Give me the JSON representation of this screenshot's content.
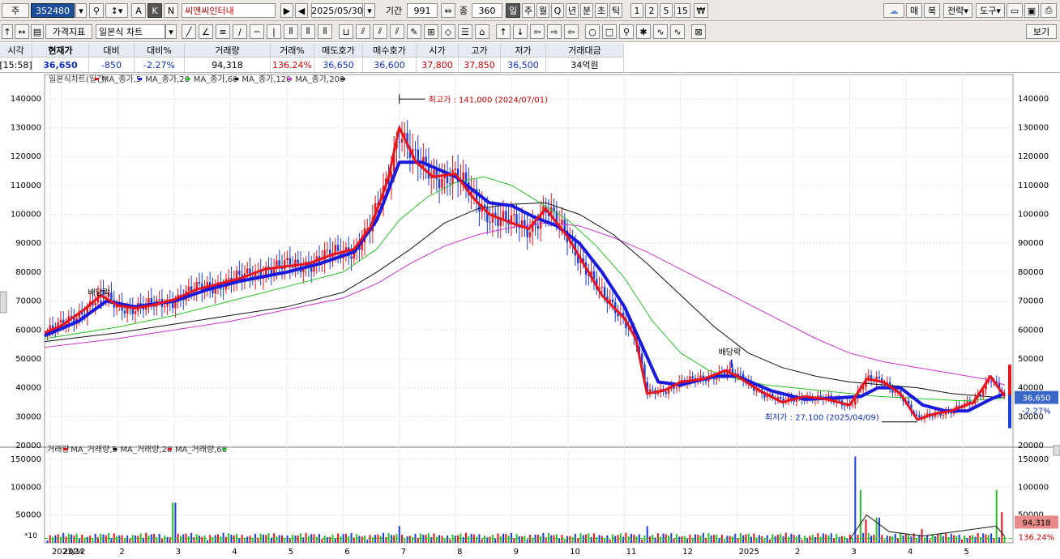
{
  "toolbar1": {
    "market_label": "주",
    "code": "352480",
    "name": "씨앤씨인터내",
    "date": "2025/05/30",
    "period_label": "기간",
    "period_value": "991",
    "count_label": "종",
    "count_value": "360",
    "mode_buttons": [
      "A",
      "K",
      "N"
    ],
    "interval_buttons": [
      "일",
      "주",
      "월",
      "Q",
      "년",
      "분",
      "초",
      "틱",
      "1",
      "2",
      "5",
      "15"
    ],
    "right_buttons": [
      "매",
      "복",
      "전략",
      "도구"
    ]
  },
  "toolbar2": {
    "indicator_label": "가격지표",
    "chart_type": "일본식 차트",
    "view_button": "보기"
  },
  "quote": {
    "headers": [
      "시각",
      "현재가",
      "대비",
      "대비%",
      "거래량",
      "거래%",
      "매도호가",
      "매수호가",
      "시가",
      "고가",
      "저가",
      "거래대금"
    ],
    "values": [
      "[15:58]",
      "36,650",
      "-850",
      "-2.27%",
      "94,318",
      "136.24%",
      "36,650",
      "36,600",
      "37,800",
      "37,850",
      "36,500",
      "34억원"
    ]
  },
  "chart_data": {
    "type": "line",
    "price_legend": [
      "일본식차트(일간)",
      "MA_종가,5",
      "MA_종가,20",
      "MA_종가,60",
      "MA_종가,120",
      "MA_종가,200"
    ],
    "volume_legend": [
      "거래량",
      "MA_거래량,5",
      "MA_거래량,20",
      "MA_거래량,60"
    ],
    "price_axis_ticks": [
      "140000",
      "130000",
      "120000",
      "110000",
      "100000",
      "90000",
      "80000",
      "70000",
      "60000",
      "50000",
      "40000",
      "30000",
      "20000"
    ],
    "volume_axis_ticks": [
      "150000",
      "100000",
      "50000"
    ],
    "volume_scale_label": "*10",
    "x_labels": [
      "2023/12",
      "2024",
      "2",
      "3",
      "4",
      "5",
      "6",
      "7",
      "8",
      "9",
      "10",
      "11",
      "12",
      "2025",
      "2",
      "3",
      "4",
      "5"
    ],
    "x_months": [
      -0.2,
      0,
      1,
      2,
      3,
      4,
      5,
      6,
      7,
      8,
      9,
      10,
      11,
      12,
      13,
      14,
      15,
      16
    ],
    "price_ylim": [
      20000,
      145000
    ],
    "volume_ylim": [
      0,
      160000
    ],
    "annotations": {
      "high": "최고가 : 141,000 (2024/07/01)",
      "low": "최저가 : 27,100 (2025/04/09)",
      "dividend1": "배당락",
      "dividend2": "배당락",
      "current_price": "36,650",
      "current_change": "-2.27%",
      "current_volume": "94,318",
      "current_volume_pct": "136.24%"
    },
    "colors": {
      "ma5": "#e8141c",
      "ma20": "#1a1adc",
      "ma60": "#27c227",
      "ma120": "#111111",
      "ma200": "#d030d0",
      "up": "#e8141c",
      "down": "#1a3cdc"
    },
    "ma5": [
      [
        -0.3,
        59000
      ],
      [
        0,
        61500
      ],
      [
        0.4,
        67000
      ],
      [
        0.7,
        72000
      ],
      [
        1,
        68500
      ],
      [
        1.3,
        67500
      ],
      [
        1.6,
        68500
      ],
      [
        2,
        70500
      ],
      [
        2.4,
        74000
      ],
      [
        2.8,
        76000
      ],
      [
        3.2,
        78000
      ],
      [
        3.6,
        81000
      ],
      [
        4,
        82000
      ],
      [
        4.4,
        83000
      ],
      [
        4.8,
        86000
      ],
      [
        5.2,
        88000
      ],
      [
        5.5,
        96000
      ],
      [
        5.8,
        112000
      ],
      [
        6,
        130000
      ],
      [
        6.3,
        118000
      ],
      [
        6.6,
        113000
      ],
      [
        7,
        114000
      ],
      [
        7.3,
        106000
      ],
      [
        7.6,
        100000
      ],
      [
        8,
        97000
      ],
      [
        8.3,
        95000
      ],
      [
        8.6,
        102000
      ],
      [
        9,
        92000
      ],
      [
        9.3,
        82000
      ],
      [
        9.6,
        72000
      ],
      [
        10,
        64000
      ],
      [
        10.2,
        57000
      ],
      [
        10.4,
        38000
      ],
      [
        10.7,
        39000
      ],
      [
        11,
        42000
      ],
      [
        11.4,
        43000
      ],
      [
        11.8,
        46000
      ],
      [
        12,
        44000
      ],
      [
        12.4,
        39000
      ],
      [
        12.8,
        35000
      ],
      [
        13.2,
        37000
      ],
      [
        13.6,
        36000
      ],
      [
        14,
        34000
      ],
      [
        14.3,
        43000
      ],
      [
        14.6,
        42000
      ],
      [
        14.9,
        38000
      ],
      [
        15.2,
        29000
      ],
      [
        15.5,
        31000
      ],
      [
        15.8,
        32000
      ],
      [
        16.2,
        35000
      ],
      [
        16.5,
        44000
      ],
      [
        16.75,
        37000
      ]
    ],
    "ma20": [
      [
        -0.3,
        58000
      ],
      [
        0.3,
        63000
      ],
      [
        0.8,
        70000
      ],
      [
        1.3,
        68000
      ],
      [
        2,
        70000
      ],
      [
        2.6,
        74000
      ],
      [
        3.2,
        77000
      ],
      [
        4,
        80000
      ],
      [
        4.6,
        83000
      ],
      [
        5.2,
        87000
      ],
      [
        5.6,
        98000
      ],
      [
        6,
        118000
      ],
      [
        6.4,
        118000
      ],
      [
        7,
        113000
      ],
      [
        7.6,
        104000
      ],
      [
        8,
        103000
      ],
      [
        8.4,
        99000
      ],
      [
        8.8,
        96000
      ],
      [
        9.2,
        90000
      ],
      [
        9.6,
        80000
      ],
      [
        10,
        68000
      ],
      [
        10.3,
        55000
      ],
      [
        10.6,
        42000
      ],
      [
        11,
        41000
      ],
      [
        11.6,
        44000
      ],
      [
        12,
        44000
      ],
      [
        12.6,
        39000
      ],
      [
        13.2,
        36000
      ],
      [
        13.8,
        36500
      ],
      [
        14.2,
        37000
      ],
      [
        14.5,
        40000
      ],
      [
        14.9,
        40000
      ],
      [
        15.3,
        34000
      ],
      [
        15.7,
        32000
      ],
      [
        16.1,
        32000
      ],
      [
        16.5,
        36000
      ],
      [
        16.75,
        38000
      ]
    ],
    "ma60": [
      [
        -0.3,
        57000
      ],
      [
        1,
        61000
      ],
      [
        2,
        65000
      ],
      [
        3,
        70000
      ],
      [
        4,
        75000
      ],
      [
        5,
        80000
      ],
      [
        5.6,
        88000
      ],
      [
        6,
        98000
      ],
      [
        6.5,
        106000
      ],
      [
        7,
        111000
      ],
      [
        7.5,
        113000
      ],
      [
        8,
        110000
      ],
      [
        8.5,
        104000
      ],
      [
        9,
        98000
      ],
      [
        9.5,
        89000
      ],
      [
        10,
        78000
      ],
      [
        10.5,
        63000
      ],
      [
        11,
        52000
      ],
      [
        11.5,
        46000
      ],
      [
        12,
        43000
      ],
      [
        12.5,
        41000
      ],
      [
        13,
        40000
      ],
      [
        13.5,
        39000
      ],
      [
        14,
        38000
      ],
      [
        14.5,
        37000
      ],
      [
        15,
        36500
      ],
      [
        15.5,
        36000
      ],
      [
        16,
        35500
      ],
      [
        16.5,
        36000
      ],
      [
        16.75,
        36500
      ]
    ],
    "ma120": [
      [
        -0.3,
        56000
      ],
      [
        1,
        59000
      ],
      [
        2,
        62000
      ],
      [
        3,
        65000
      ],
      [
        4,
        68000
      ],
      [
        5,
        73000
      ],
      [
        5.6,
        80000
      ],
      [
        6.2,
        88000
      ],
      [
        6.8,
        97000
      ],
      [
        7.4,
        102000
      ],
      [
        8,
        103500
      ],
      [
        8.6,
        104000
      ],
      [
        9.2,
        100000
      ],
      [
        9.8,
        93000
      ],
      [
        10.4,
        83000
      ],
      [
        11,
        72000
      ],
      [
        11.6,
        61000
      ],
      [
        12.2,
        52000
      ],
      [
        12.8,
        47000
      ],
      [
        13.4,
        44000
      ],
      [
        14,
        42000
      ],
      [
        14.6,
        41000
      ],
      [
        15.2,
        40000
      ],
      [
        15.8,
        38000
      ],
      [
        16.4,
        37000
      ],
      [
        16.75,
        36500
      ]
    ],
    "ma200": [
      [
        -0.3,
        54000
      ],
      [
        1,
        57000
      ],
      [
        2,
        60000
      ],
      [
        3,
        63000
      ],
      [
        4,
        67000
      ],
      [
        5,
        71000
      ],
      [
        5.6,
        76000
      ],
      [
        6.2,
        83000
      ],
      [
        6.8,
        89000
      ],
      [
        7.4,
        93000
      ],
      [
        8,
        95500
      ],
      [
        8.6,
        97000
      ],
      [
        9.2,
        96000
      ],
      [
        9.8,
        92000
      ],
      [
        10.4,
        87000
      ],
      [
        11,
        81000
      ],
      [
        11.6,
        75000
      ],
      [
        12.2,
        69000
      ],
      [
        12.8,
        63000
      ],
      [
        13.4,
        57000
      ],
      [
        14,
        52000
      ],
      [
        14.6,
        49000
      ],
      [
        15.2,
        47000
      ],
      [
        15.8,
        45000
      ],
      [
        16.4,
        43000
      ],
      [
        16.75,
        41000
      ]
    ],
    "volume_spikes": [
      [
        2,
        72000
      ],
      [
        6,
        30000
      ],
      [
        10.4,
        30000
      ],
      [
        14.1,
        155000
      ],
      [
        14.2,
        95000
      ],
      [
        14.3,
        42000
      ],
      [
        14.5,
        45000
      ],
      [
        15.3,
        25000
      ],
      [
        16.6,
        95000
      ],
      [
        16.7,
        55000
      ]
    ]
  }
}
